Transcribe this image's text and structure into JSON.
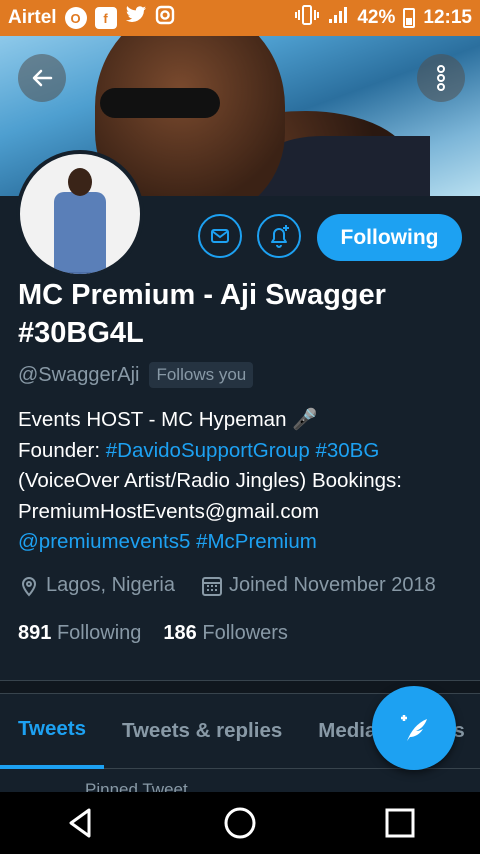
{
  "status_bar": {
    "carrier": "Airtel",
    "battery": "42%",
    "time": "12:15",
    "icons": [
      "opera-icon",
      "facebook-icon",
      "twitter-icon",
      "instagram-icon",
      "vibrate-icon",
      "signal-icon",
      "battery-icon"
    ]
  },
  "profile": {
    "name": "MC Premium - Aji Swagger #30BG4L",
    "handle": "@SwaggerAji",
    "follows_you": "Follows you",
    "follow_button": "Following",
    "bio": {
      "line1": "Events HOST - MC Hypeman 🎤",
      "line2_prefix": "Founder: ",
      "line2_link1": "#DavidoSupportGroup",
      "line2_link2": "#30BG",
      "line3": "(VoiceOver Artist/Radio Jingles) Bookings:",
      "line4": "PremiumHostEvents@gmail.com",
      "line5_link1": "@premiumevents5",
      "line5_link2": "#McPremium"
    },
    "location": "Lagos, Nigeria",
    "joined": "Joined November 2018",
    "following_count": "891",
    "following_label": "Following",
    "followers_count": "186",
    "followers_label": "Followers"
  },
  "tabs": [
    "Tweets",
    "Tweets & replies",
    "Media",
    "Likes"
  ],
  "pinned": "Pinned Tweet",
  "colors": {
    "accent": "#1da1f2",
    "background": "#15202b",
    "muted": "#8899a6",
    "status_bar": "#e07a22"
  }
}
